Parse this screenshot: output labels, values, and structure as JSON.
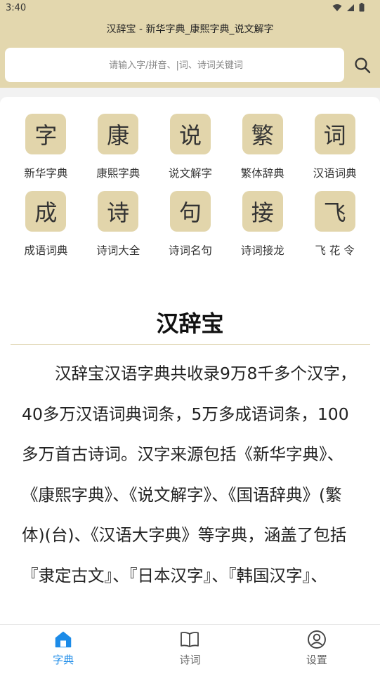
{
  "status": {
    "time": "3:40",
    "icons": [
      "wifi-icon",
      "signal-icon",
      "battery-icon"
    ]
  },
  "header": {
    "title": "汉辞宝 - 新华字典_康熙字典_说文解字",
    "search_placeholder": "请输入字/拼音、|词、诗词关键词",
    "search_icon": "search-icon"
  },
  "grid": [
    {
      "glyph": "字",
      "label": "新华字典"
    },
    {
      "glyph": "康",
      "label": "康熙字典"
    },
    {
      "glyph": "说",
      "label": "说文解字"
    },
    {
      "glyph": "繁",
      "label": "繁体辞典"
    },
    {
      "glyph": "词",
      "label": "汉语词典"
    },
    {
      "glyph": "成",
      "label": "成语词典"
    },
    {
      "glyph": "诗",
      "label": "诗词大全"
    },
    {
      "glyph": "句",
      "label": "诗词名句"
    },
    {
      "glyph": "接",
      "label": "诗词接龙"
    },
    {
      "glyph": "飞",
      "label": "飞 花 令"
    }
  ],
  "article": {
    "title": "汉辞宝",
    "body": "汉辞宝汉语字典共收录9万8千多个汉字，40多万汉语词典词条，5万多成语词条，100多万首古诗词。汉字来源包括《新华字典》、《康熙字典》、《说文解字》、《国语辞典》(繁体)(台)、《汉语大字典》等字典，涵盖了包括『隶定古文』、『日本汉字』、『韩国汉字』、"
  },
  "bottom_nav": [
    {
      "label": "字典",
      "icon": "home-icon",
      "active": true
    },
    {
      "label": "诗词",
      "icon": "book-icon",
      "active": false
    },
    {
      "label": "设置",
      "icon": "user-icon",
      "active": false
    }
  ],
  "colors": {
    "header_bg": "#e3d7ae",
    "tile_bg": "#e2d5ab",
    "accent": "#1c8be8",
    "page_bg": "#f2f2f2"
  }
}
